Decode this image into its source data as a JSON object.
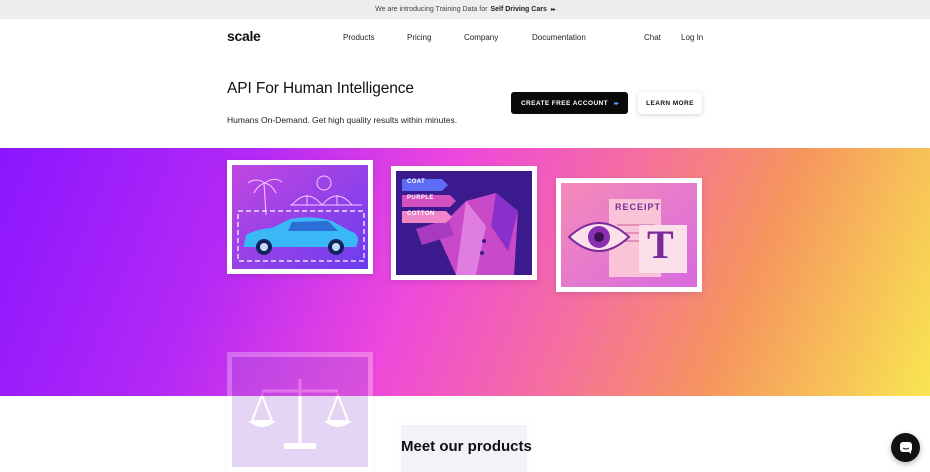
{
  "announcement": {
    "text": "We are introducing Training Data for",
    "highlight": "Self Driving Cars",
    "arrow": "▸▸"
  },
  "nav": {
    "logo": "scale",
    "links": [
      "Products",
      "Pricing",
      "Company",
      "Documentation"
    ],
    "right_links": [
      "Chat",
      "Log In"
    ]
  },
  "hero": {
    "title": "API For Human Intelligence",
    "subtitle": "Humans On-Demand. Get high quality results within minutes.",
    "primary_button": "CREATE FREE ACCOUNT",
    "primary_arrow": "▸▸",
    "secondary_button": "LEARN MORE"
  },
  "cards": {
    "tags": [
      "COAT",
      "PURPLE",
      "COTTON"
    ],
    "receipt_label": "RECEIPT",
    "t_letter": "T"
  },
  "section": {
    "title": "Meet our products"
  },
  "colors": {
    "gradient": [
      "#8a16ff",
      "#ee48dc",
      "#f6955e",
      "#f8e652"
    ],
    "button_primary": "#0a0a0a",
    "chat_bubble": "#111111"
  },
  "icons": [
    "palm-tree-icon",
    "bridge-icon",
    "car-icon",
    "arrow-icon",
    "eye-icon",
    "scale-icon",
    "chat-icon"
  ]
}
